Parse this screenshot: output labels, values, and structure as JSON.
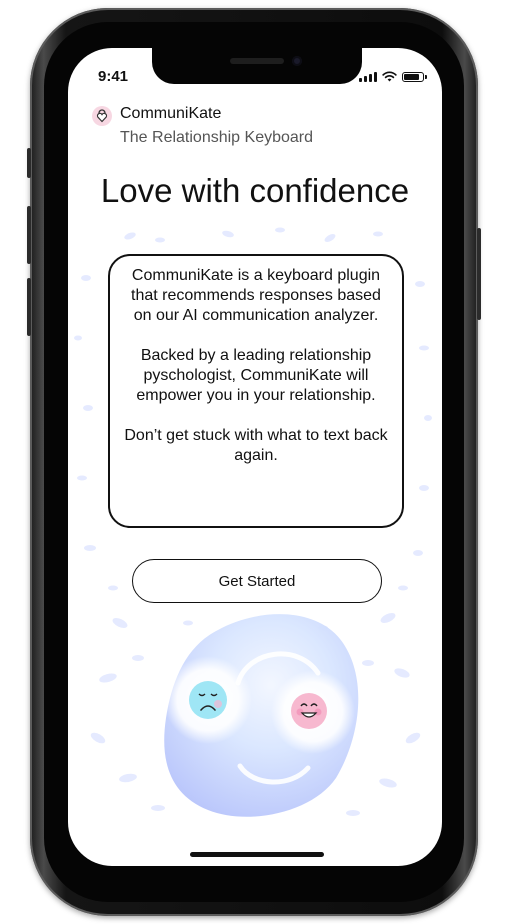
{
  "status_bar": {
    "time": "9:41"
  },
  "app": {
    "name": "CommuniKate",
    "tagline": "The Relationship Keyboard"
  },
  "headline": "Love with confidence",
  "card": {
    "paragraph_1": "CommuniKate is a keyboard plugin that recommends responses based on our AI communication analyzer.",
    "paragraph_2": "Backed by a leading relationship pyschologist, CommuniKate will empower you in your relationship.",
    "paragraph_3": "Don’t get stuck with what to text back again."
  },
  "cta": {
    "label": "Get Started"
  },
  "colors": {
    "accent_blob": "#dbe3ff",
    "sad_face": "#9fe6f5",
    "happy_face": "#f7b8cf"
  },
  "icons": [
    "signal-icon",
    "wifi-icon",
    "battery-icon",
    "app-logo-icon",
    "sad-face-icon",
    "happy-face-icon"
  ]
}
